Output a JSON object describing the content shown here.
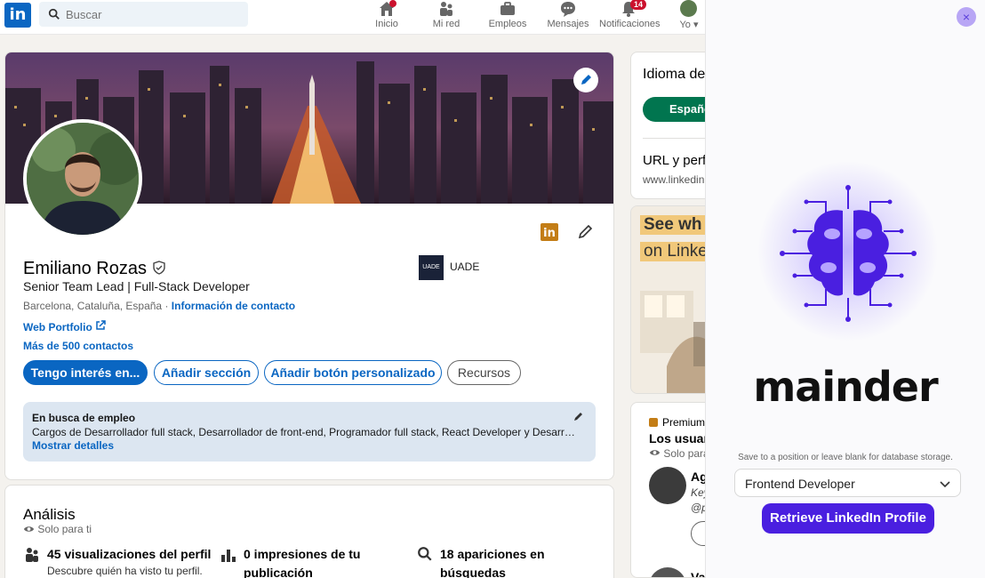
{
  "nav": {
    "search_placeholder": "Buscar",
    "items": [
      {
        "label": "Inicio",
        "icon": "home-icon"
      },
      {
        "label": "Mi red",
        "icon": "network-icon"
      },
      {
        "label": "Empleos",
        "icon": "briefcase-icon"
      },
      {
        "label": "Mensajes",
        "icon": "messages-icon"
      },
      {
        "label": "Notificaciones",
        "icon": "bell-icon",
        "badge": "14"
      },
      {
        "label": "Yo",
        "icon": "avatar-icon"
      }
    ]
  },
  "profile": {
    "name": "Emiliano Rozas",
    "headline": "Senior Team Lead | Full-Stack Developer",
    "location": "Barcelona, Cataluña, España · ",
    "contact_link": "Información de contacto",
    "portfolio": "Web Portfolio",
    "contacts": "Más de 500 contactos",
    "education": "UADE",
    "education_logo": "UADE",
    "buttons": {
      "open_to": "Tengo interés en...",
      "add_section": "Añadir sección",
      "add_custom_button": "Añadir botón personalizado",
      "resources": "Recursos"
    },
    "job_search": {
      "title": "En busca de empleo",
      "description": "Cargos de Desarrollador full stack, Desarrollador de front-end, Programador full stack, React Developer y Desarrollador web",
      "more": "Mostrar detalles"
    }
  },
  "analytics": {
    "title": "Análisis",
    "privacy": "Solo para ti",
    "stats": [
      {
        "title": "45 visualizaciones del perfil",
        "sub": "Descubre quién ha visto tu perfil."
      },
      {
        "title_line1": "0 impresiones de tu",
        "title_line2": "publicación"
      },
      {
        "title_line1": "18 apariciones en",
        "title_line2": "búsquedas"
      }
    ]
  },
  "right_column": {
    "language_title": "Idioma de",
    "language_button": "Españo",
    "url_title": "URL y perf",
    "url_value": "www.linkedin",
    "ad_line1": "See wh",
    "ad_line2": "on Linke",
    "premium_label": "Premium",
    "premium_title": "Los usuari",
    "premium_privacy": "Solo para",
    "person_name": "Ag",
    "person_sub1": "Key",
    "person_sub2": "@p",
    "person2_name": "Va"
  },
  "panel": {
    "brand": "mainder",
    "hint": "Save to a position or leave blank for database storage.",
    "select_value": "Frontend Developer",
    "retrieve_button": "Retrieve LinkedIn Profile",
    "close_symbol": "×"
  },
  "colors": {
    "linkedin_blue": "#0a66c2",
    "mainder_purple": "#4a1fe0",
    "badge_red": "#cb112d",
    "green_button": "#01754f"
  }
}
